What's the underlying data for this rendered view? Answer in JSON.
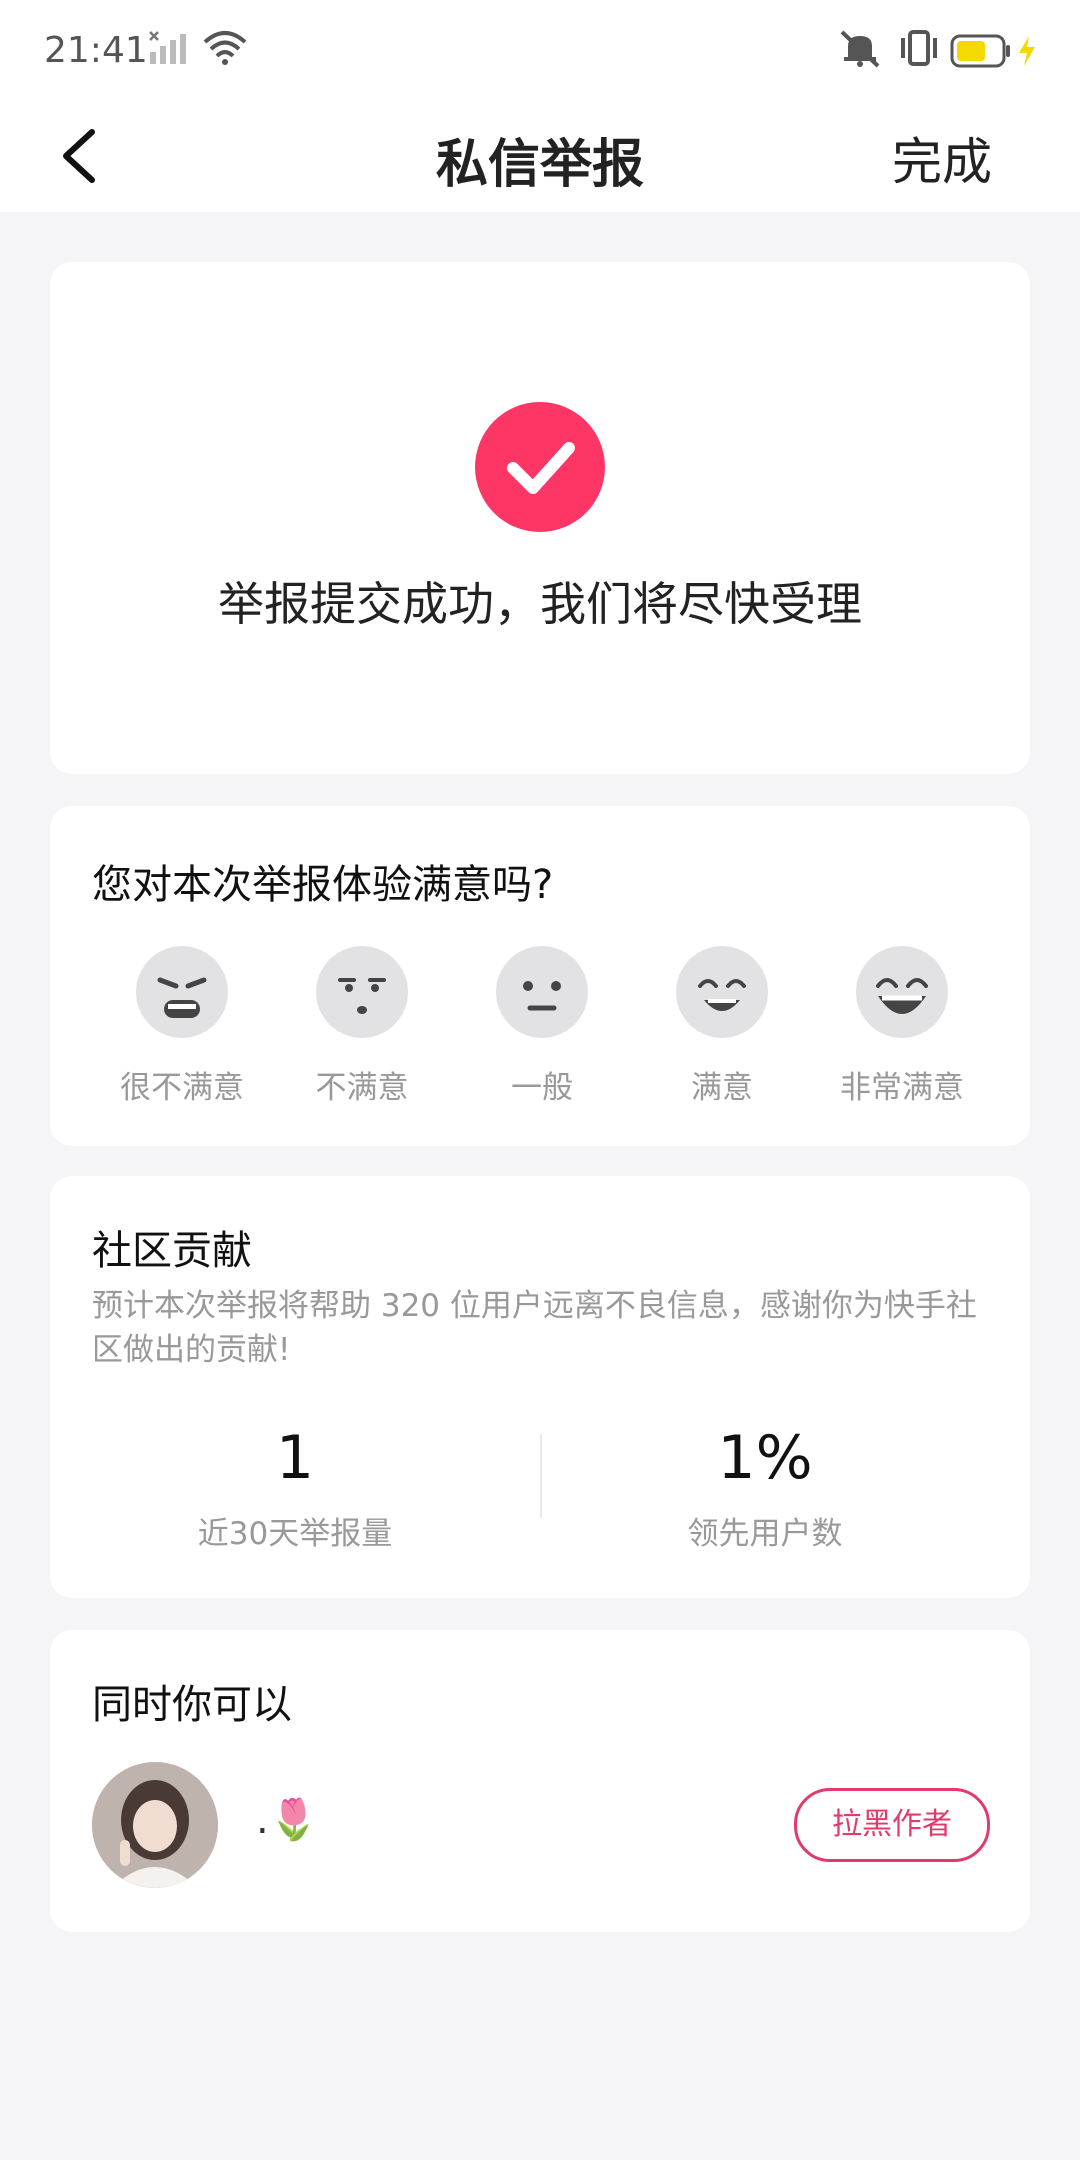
{
  "status_bar": {
    "time": "21:41",
    "icons": [
      "signal-icon",
      "wifi-icon",
      "mute-icon",
      "vibrate-icon",
      "battery-icon",
      "charging-icon"
    ]
  },
  "header": {
    "title": "私信举报",
    "done_label": "完成",
    "back_icon": "chevron-left-icon"
  },
  "success_card": {
    "message": "举报提交成功，我们将尽快受理",
    "icon": "check-icon",
    "accent_color": "#fe3666"
  },
  "survey": {
    "question": "您对本次举报体验满意吗?",
    "options": [
      {
        "label": "很不满意",
        "icon": "angry-face-icon"
      },
      {
        "label": "不满意",
        "icon": "unhappy-face-icon"
      },
      {
        "label": "一般",
        "icon": "neutral-face-icon"
      },
      {
        "label": "满意",
        "icon": "smile-face-icon"
      },
      {
        "label": "非常满意",
        "icon": "laugh-face-icon"
      }
    ]
  },
  "contribution": {
    "title": "社区贡献",
    "description": "预计本次举报将帮助 320 位用户远离不良信息，感谢你为快手社区做出的贡献!",
    "stats": [
      {
        "value": "1",
        "label": "近30天举报量"
      },
      {
        "value": "1%",
        "label": "领先用户数"
      }
    ]
  },
  "also": {
    "title": "同时你可以",
    "user_name": ".🌷",
    "block_label": "拉黑作者",
    "block_color": "#e23a6a"
  }
}
